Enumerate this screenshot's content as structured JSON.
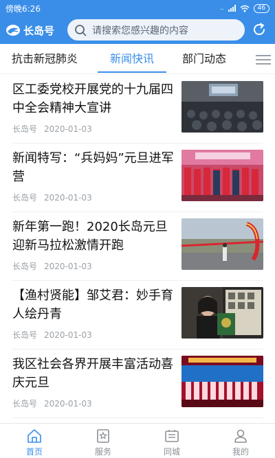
{
  "status": {
    "time": "傍晚6:26",
    "signal": "..il",
    "battery": "46"
  },
  "header": {
    "app_name": "长岛号",
    "search_placeholder": "请搜索您感兴趣的内容",
    "colors": {
      "brand": "#3a8ee8",
      "search_bg": "#eef3f9"
    }
  },
  "tabs": [
    {
      "label": "抗击新冠肺炎"
    },
    {
      "label": "新闻快讯",
      "active": true
    },
    {
      "label": "部门动态"
    }
  ],
  "news": [
    {
      "title": "区工委党校开展党的十九届四中全会精神大宣讲",
      "source": "长岛号",
      "date": "2020-01-03"
    },
    {
      "title": "新闻特写：“兵妈妈”元旦进军营",
      "source": "长岛号",
      "date": "2020-01-03"
    },
    {
      "title": "新年第一跑！2020长岛元旦迎新马拉松激情开跑",
      "source": "长岛号",
      "date": "2020-01-03"
    },
    {
      "title": "【渔村贤能】邹艾君：妙手育人绘丹青",
      "source": "长岛号",
      "date": "2020-01-03"
    },
    {
      "title": "我区社会各界开展丰富活动喜庆元旦",
      "source": "长岛号",
      "date": "2020-01-03"
    }
  ],
  "bottom_nav": [
    {
      "label": "首页",
      "icon": "home-icon",
      "active": true
    },
    {
      "label": "服务",
      "icon": "service-icon"
    },
    {
      "label": "同城",
      "icon": "city-icon"
    },
    {
      "label": "我的",
      "icon": "profile-icon"
    }
  ]
}
